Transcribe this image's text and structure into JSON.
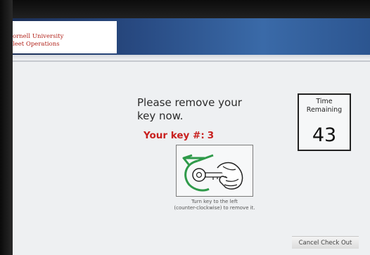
{
  "header": {
    "logo_line1": "ornell University",
    "logo_line2": "leet Operations"
  },
  "main": {
    "message_line1": "Please remove your",
    "message_line2": "key now.",
    "key_label": "Your key #:",
    "key_number": "3",
    "instruction_line1": "Turn key to the left",
    "instruction_line2": "(counter-clockwise) to remove it."
  },
  "timer": {
    "label_line1": "Time",
    "label_line2": "Remaining",
    "value": "43"
  },
  "footer": {
    "cancel_label": "Cancel Check Out"
  },
  "colors": {
    "accent_red": "#c8201f",
    "header_blue": "#284a82",
    "illustration_green": "#2f9a4a"
  },
  "icons": {
    "key_illustration": "hand-turning-key-counterclockwise-icon"
  }
}
